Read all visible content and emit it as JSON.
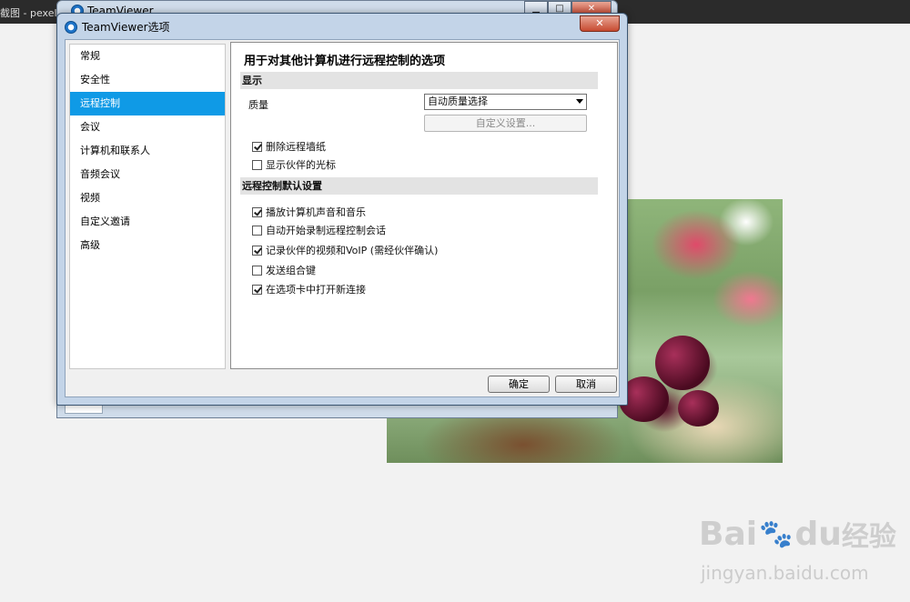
{
  "taskbar": {
    "app_title": "截图 - pexels-p"
  },
  "background_window": {
    "title": "TeamViewer"
  },
  "dialog": {
    "title": "TeamViewer选项",
    "close_label": "✕",
    "nav": [
      {
        "label": "常规"
      },
      {
        "label": "安全性"
      },
      {
        "label": "远程控制",
        "active": true
      },
      {
        "label": "会议"
      },
      {
        "label": "计算机和联系人"
      },
      {
        "label": "音频会议"
      },
      {
        "label": "视频"
      },
      {
        "label": "自定义邀请"
      },
      {
        "label": "高级"
      }
    ],
    "panel": {
      "heading": "用于对其他计算机进行远程控制的选项",
      "section_display": "显示",
      "quality_label": "质量",
      "quality_value": "自动质量选择",
      "custom_settings_button": "自定义设置...",
      "display_options": [
        {
          "label": "删除远程墙纸",
          "checked": true
        },
        {
          "label": "显示伙伴的光标",
          "checked": false
        }
      ],
      "section_defaults": "远程控制默认设置",
      "default_options": [
        {
          "label": "播放计算机声音和音乐",
          "checked": true
        },
        {
          "label": "自动开始录制远程控制会话",
          "checked": false
        },
        {
          "label": "记录伙伴的视频和VoIP (需经伙伴确认)",
          "checked": true
        },
        {
          "label": "发送组合键",
          "checked": false
        },
        {
          "label": "在选项卡中打开新连接",
          "checked": true
        }
      ]
    },
    "ok_button": "确定",
    "cancel_button": "取消"
  },
  "watermark": {
    "brand": "Bai",
    "brand2": "du",
    "suffix": "经验",
    "url": "jingyan.baidu.com"
  },
  "colors": {
    "nav_active": "#0f9ae6",
    "dialog_frame": "#c3d4e8",
    "close_red": "#c74a30"
  }
}
